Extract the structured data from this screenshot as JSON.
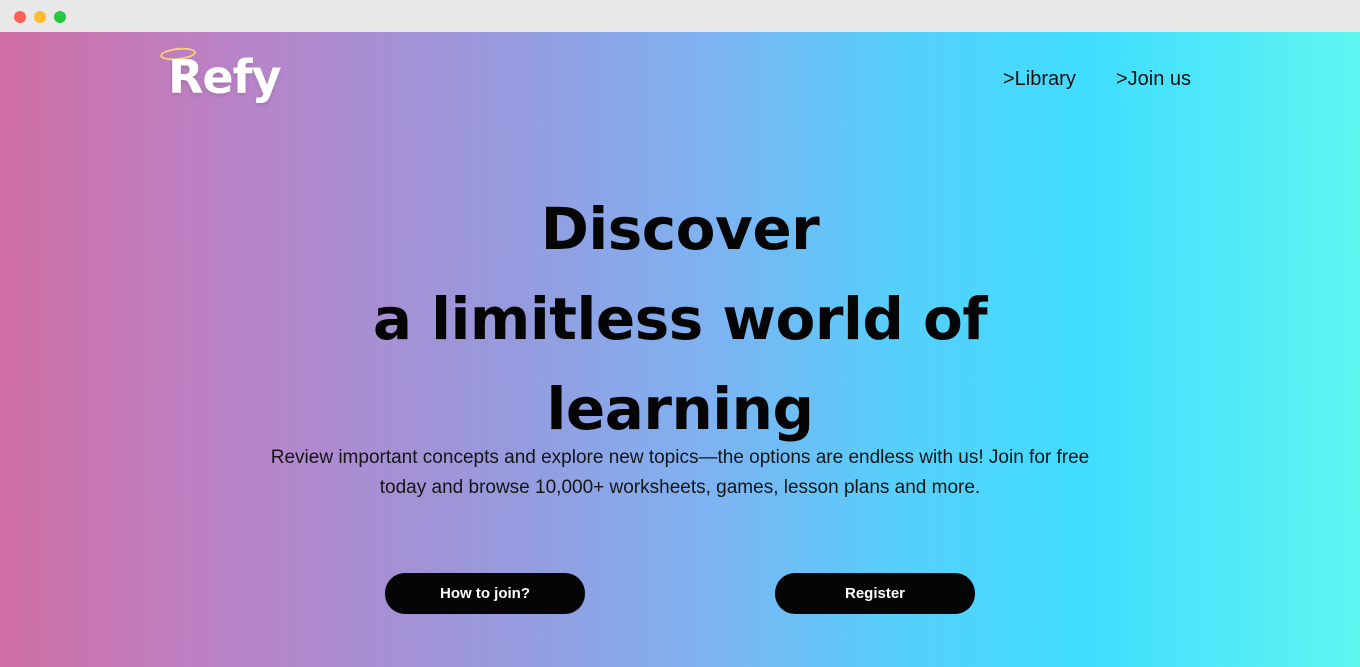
{
  "window": {
    "controls": [
      "close",
      "minimize",
      "zoom"
    ]
  },
  "header": {
    "logo_text": "Refy",
    "nav": [
      {
        "label": ">Library"
      },
      {
        "label": ">Join us"
      }
    ]
  },
  "hero": {
    "title_lines": [
      "Discover",
      "a limitless world of",
      "learning"
    ],
    "subtitle_line1": "Review important concepts and explore new topics—the options are endless with us! Join for free",
    "subtitle_line2": "today and browse 10,000+ worksheets, games, lesson plans and more."
  },
  "actions": {
    "how_to_join": "How to join?",
    "register": "Register"
  },
  "colors": {
    "gradient_start": "#d06fa4",
    "gradient_mid": "#7fb2f2",
    "gradient_end": "#5ff6f0",
    "button_bg": "#050505",
    "button_text": "#ffffff"
  }
}
